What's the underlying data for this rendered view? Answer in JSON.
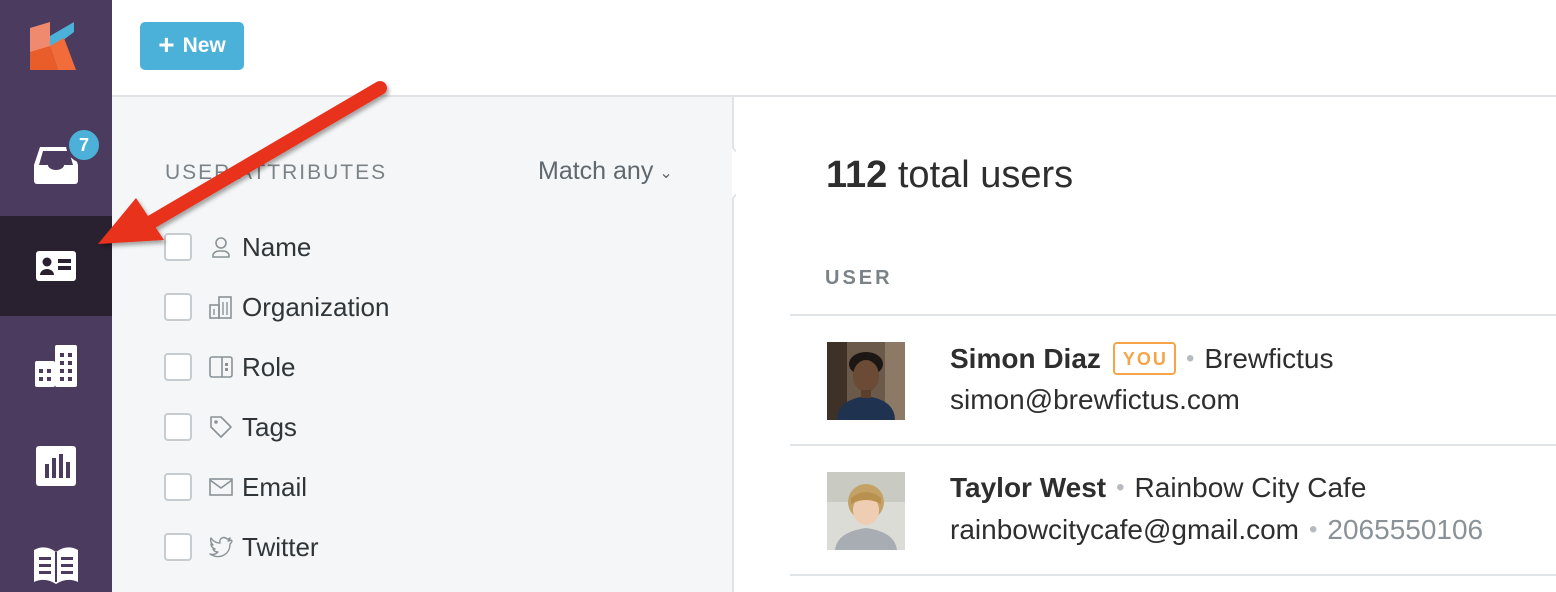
{
  "sidebar": {
    "inbox_badge": "7",
    "items": [
      {
        "name": "inbox",
        "icon": "inbox-tray-icon"
      },
      {
        "name": "users",
        "icon": "contact-card-icon",
        "active": true
      },
      {
        "name": "organizations",
        "icon": "buildings-icon"
      },
      {
        "name": "reports",
        "icon": "bar-chart-icon"
      },
      {
        "name": "knowledge-base",
        "icon": "open-book-icon"
      }
    ],
    "colors": {
      "bg": "#4b3b5f",
      "active_bg": "#2a2130",
      "badge": "#4cb1d8"
    }
  },
  "toolbar": {
    "new_label": "New",
    "new_icon": "plus-icon",
    "accent": "#4cb1d8"
  },
  "filters": {
    "header": "USER ATTRIBUTES",
    "match_label": "Match any",
    "items": [
      {
        "label": "Name",
        "icon": "person-icon",
        "checked": false
      },
      {
        "label": "Organization",
        "icon": "building-icon",
        "checked": false
      },
      {
        "label": "Role",
        "icon": "role-panel-icon",
        "checked": false
      },
      {
        "label": "Tags",
        "icon": "tag-icon",
        "checked": false
      },
      {
        "label": "Email",
        "icon": "envelope-icon",
        "checked": false
      },
      {
        "label": "Twitter",
        "icon": "twitter-bird-icon",
        "checked": false
      }
    ]
  },
  "main": {
    "total_count": "112",
    "total_suffix": "total users",
    "column_header": "USER",
    "users": [
      {
        "name": "Simon Diaz",
        "you_badge": "YOU",
        "organization": "Brewfictus",
        "email": "simon@brewfictus.com",
        "phone": ""
      },
      {
        "name": "Taylor West",
        "you_badge": "",
        "organization": "Rainbow City Cafe",
        "email": "rainbowcitycafe@gmail.com",
        "phone": "2065550106"
      }
    ],
    "you_color": "#f5a547"
  },
  "annotation": {
    "type": "red-arrow",
    "color": "#e8301c",
    "points_to": "sidebar-item-users"
  }
}
